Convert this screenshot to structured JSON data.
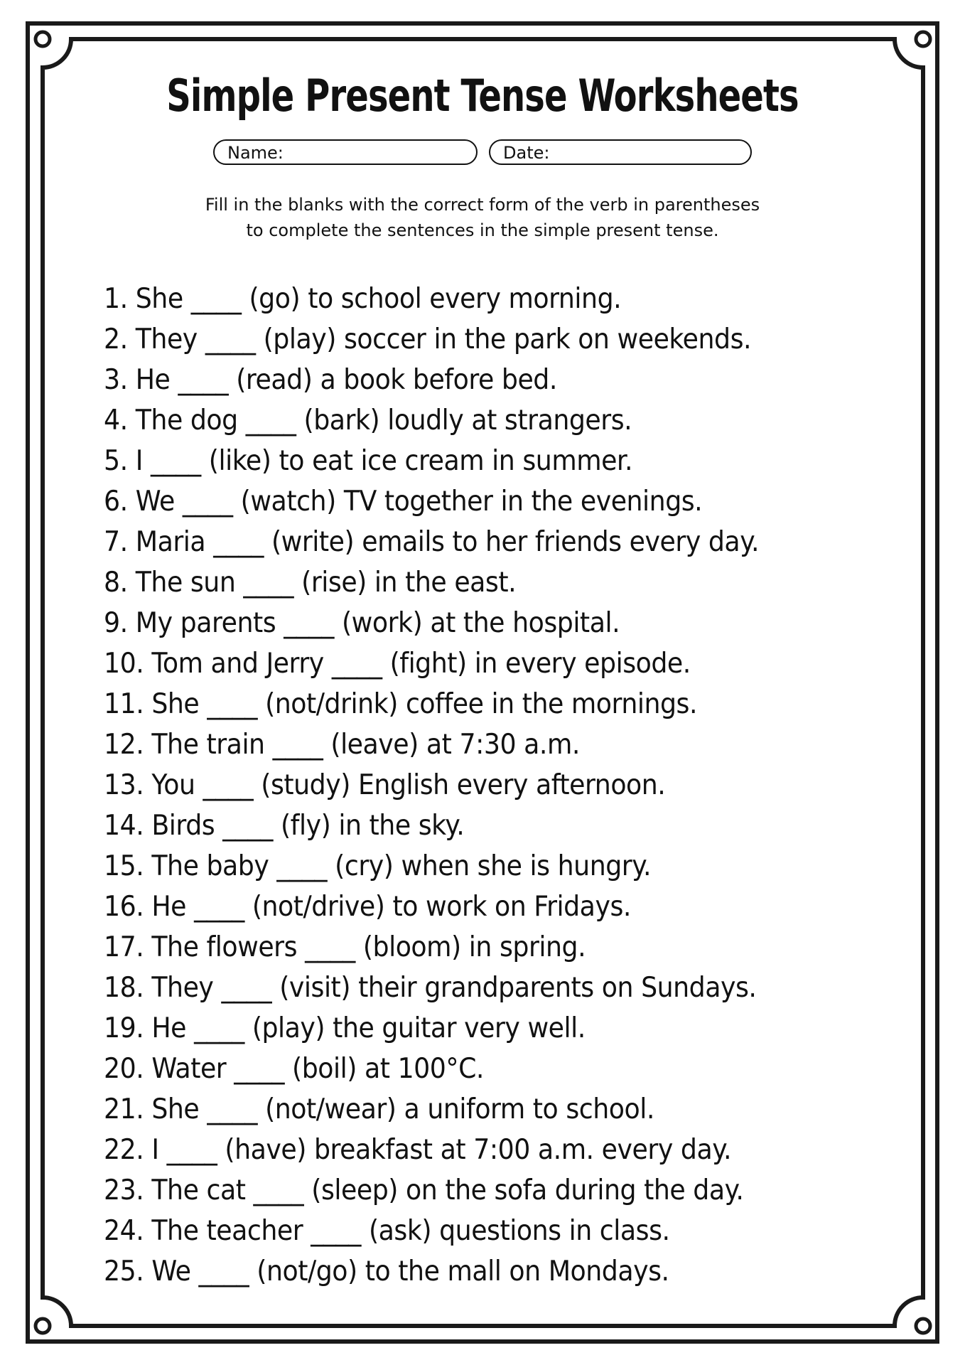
{
  "worksheet": {
    "title": "Simple Present Tense Worksheets",
    "name_label": "Name:",
    "date_label": "Date:",
    "instructions": [
      "Fill in the blanks with the correct form of the verb in parentheses",
      "to complete the sentences in the simple present tense."
    ],
    "items": [
      "1. She ____ (go) to school every morning.",
      "2. They ____ (play) soccer in the park on weekends.",
      "3. He ____ (read) a book before bed.",
      "4. The dog ____ (bark) loudly at strangers.",
      "5. I ____ (like) to eat ice cream in summer.",
      "6. We ____ (watch) TV together in the evenings.",
      "7. Maria ____ (write) emails to her friends every day.",
      "8. The sun ____ (rise) in the east.",
      "9. My parents ____ (work) at the hospital.",
      "10. Tom and Jerry ____ (fight) in every episode.",
      "11. She ____ (not/drink) coffee in the mornings.",
      "12. The train ____ (leave) at 7:30 a.m.",
      "13. You ____ (study) English every afternoon.",
      "14. Birds ____ (fly) in the sky.",
      "15. The baby ____ (cry) when she is hungry.",
      "16. He ____ (not/drive) to work on Fridays.",
      "17. The flowers ____ (bloom) in spring.",
      "18. They ____ (visit) their grandparents on Sundays.",
      "19. He ____ (play) the guitar very well.",
      "20. Water ____ (boil) at 100°C.",
      "21. She ____ (not/wear) a uniform to school.",
      "22. I ____ (have) breakfast at 7:00 a.m. every day.",
      "23. The cat ____ (sleep) on the sofa during the day.",
      "24. The teacher ____ (ask) questions in class.",
      "25. We ____ (not/go) to the mall on Mondays."
    ]
  }
}
